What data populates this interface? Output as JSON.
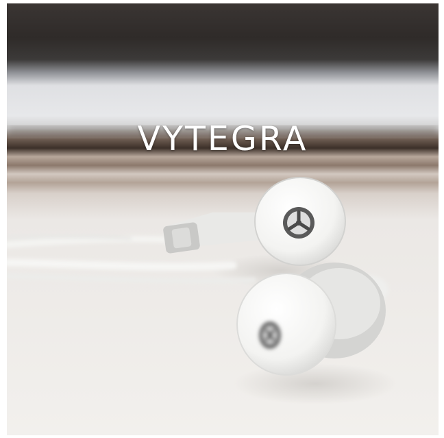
{
  "image": {
    "subject": "earbuds-photo",
    "headline": "VYTEGRA"
  },
  "palette": {
    "dark_top": "#2f2b29",
    "window_light": "#e4e5e7",
    "wood_band": "#8f7a6d",
    "surface": "#efedea",
    "earbud_white": "#f8f8f6",
    "cable": "#f3f3f1",
    "grille": "#4a4a4a"
  }
}
